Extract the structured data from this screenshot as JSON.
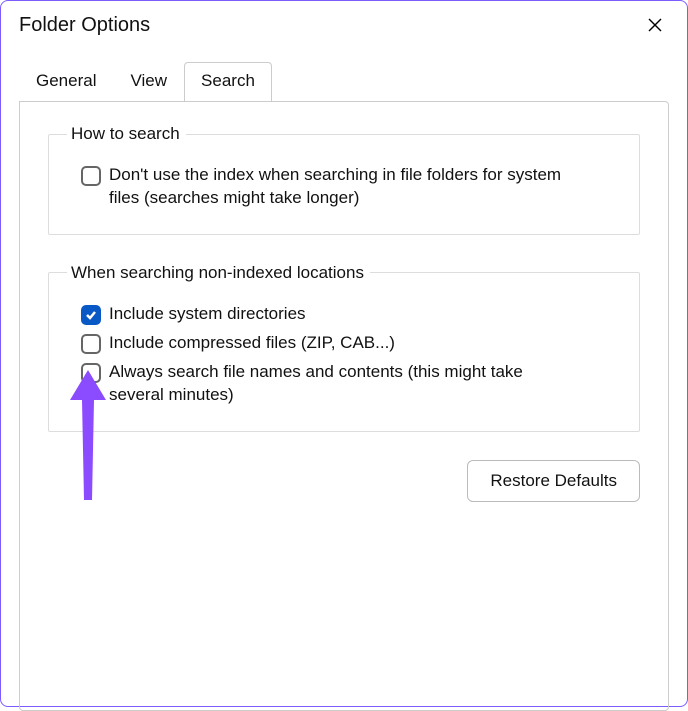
{
  "window": {
    "title": "Folder Options"
  },
  "tabs": {
    "general": "General",
    "view": "View",
    "search": "Search"
  },
  "group1": {
    "legend": "How to search",
    "option1": "Don't use the index when searching in file folders for system files (searches might take longer)"
  },
  "group2": {
    "legend": "When searching non-indexed locations",
    "option1": "Include system directories",
    "option2": "Include compressed files (ZIP, CAB...)",
    "option3": "Always search file names and contents (this might take several minutes)"
  },
  "buttons": {
    "restore": "Restore Defaults"
  },
  "states": {
    "g1_o1_checked": false,
    "g2_o1_checked": true,
    "g2_o2_checked": false,
    "g2_o3_checked": false
  },
  "annotation": {
    "arrow_color": "#8b4cff"
  }
}
